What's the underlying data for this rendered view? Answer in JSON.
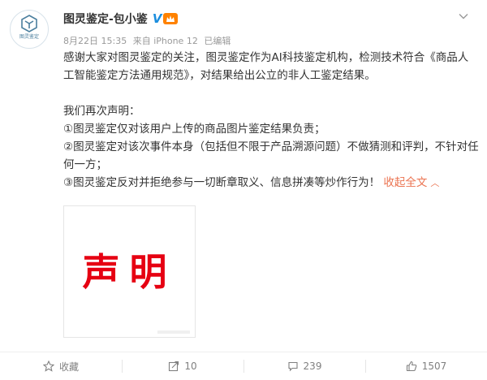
{
  "post": {
    "author": {
      "name": "图灵鉴定-包小鉴",
      "avatar_text": "图灵鉴定",
      "verified_icon": "verified-v-icon",
      "vip_badge": "VIP"
    },
    "meta": {
      "date": "8月22日 15:35",
      "source": "来自 iPhone 12",
      "edited": "已编辑"
    },
    "paragraphs": [
      "感谢大家对图灵鉴定的关注，图灵鉴定作为AI科技鉴定机构，检测技术符合《商品人工智能鉴定方法通用规范》，对结果给出公立的非人工鉴定结果。",
      "我们再次声明：",
      "①图灵鉴定仅对该用户上传的商品图片鉴定结果负责；",
      "②图灵鉴定对该次事件本身（包括但不限于产品溯源问题）不做猜测和评判，不针对任何一方；",
      "③图灵鉴定反对并拒绝参与一切断章取义、信息拼凑等炒作行为！"
    ],
    "collapse_label": "收起全文",
    "image_text": "声明"
  },
  "actions": {
    "favorite": "收藏",
    "repost": "10",
    "comment": "239",
    "like": "1507"
  },
  "colors": {
    "link": "#eb7350",
    "verified": "#1c8ede",
    "statement_red": "#e60012"
  }
}
